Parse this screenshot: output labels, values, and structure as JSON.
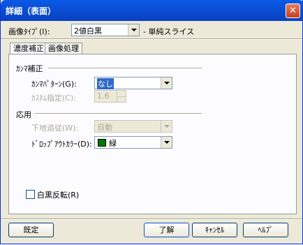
{
  "window": {
    "title": "詳細（表面）",
    "close_glyph": "✕"
  },
  "image_type": {
    "label": "画像ﾀｲﾌﾟ(I):",
    "value": "2値白黒",
    "description": "- 単純スライス"
  },
  "tabs": [
    {
      "label": "濃度補正"
    },
    {
      "label": "画像処理"
    }
  ],
  "gamma": {
    "section_title": "ｶﾝﾏ補正",
    "pattern_label": "ｶﾝﾏﾊﾟﾀｰﾝ(G):",
    "pattern_value": "なし",
    "custom_label": "ｶｽﾀﾑ指定(C):",
    "custom_value": "1.6"
  },
  "applied": {
    "section_title": "応用",
    "background_label": "下地追従(W):",
    "background_value": "自動",
    "dropout_label": "ﾄﾞﾛｯﾌﾟｱｳﾄｶﾗｰ(D):",
    "dropout_value": "緑",
    "dropout_color": "#007700"
  },
  "invert": {
    "label": "白黒反転(R)",
    "checked": false
  },
  "buttons": {
    "default": "既定",
    "ok": "了解",
    "cancel": "ｷｬﾝｾﾙ",
    "help": "ﾍﾙﾌﾟ"
  }
}
